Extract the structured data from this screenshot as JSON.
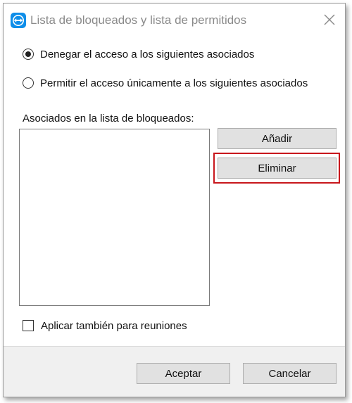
{
  "window": {
    "title": "Lista de bloqueados y lista de permitidos",
    "app_icon": "teamviewer-icon",
    "close_icon": "close-icon"
  },
  "options": {
    "deny_label": "Denegar el acceso a los siguientes asociados",
    "deny_selected": true,
    "allow_label": "Permitir el acceso únicamente a los siguientes asociados",
    "allow_selected": false
  },
  "list": {
    "label": "Asociados en la lista de bloqueados:",
    "items": []
  },
  "buttons": {
    "add_label": "Añadir",
    "remove_label": "Eliminar",
    "ok_label": "Aceptar",
    "cancel_label": "Cancelar"
  },
  "meetings": {
    "label": "Aplicar también para reuniones",
    "checked": false
  },
  "colors": {
    "highlight": "#c8171c",
    "app_icon": "#0e8ee9"
  }
}
